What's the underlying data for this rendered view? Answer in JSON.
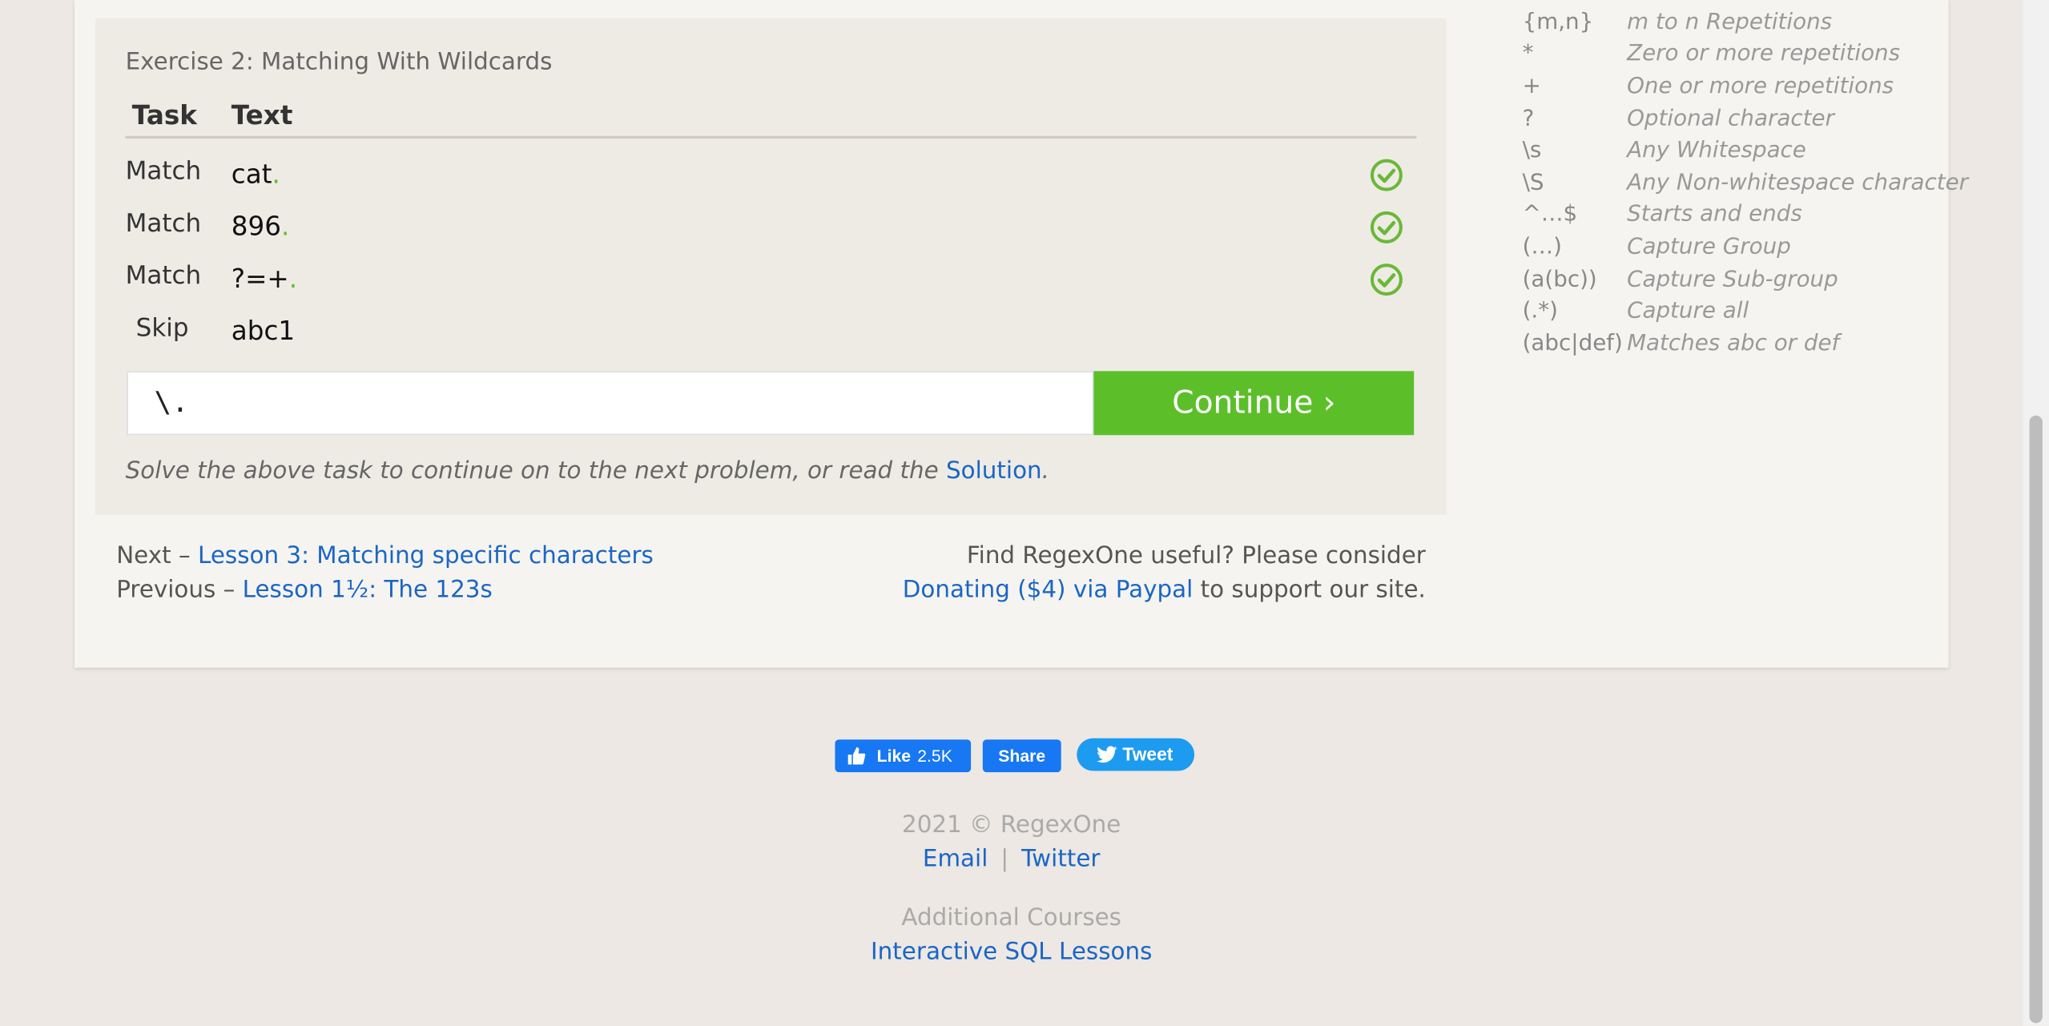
{
  "exercise": {
    "title": "Exercise 2: Matching With Wildcards",
    "col_task": "Task",
    "col_text": "Text",
    "rows": [
      {
        "task": "Match",
        "text": "cat",
        "suffix": ".",
        "status": "check-icon"
      },
      {
        "task": "Match",
        "text": "896",
        "suffix": ".",
        "status": "check-icon"
      },
      {
        "task": "Match",
        "text": "?=+",
        "suffix": ".",
        "status": "check-icon"
      },
      {
        "task": "Skip",
        "text": "abc1",
        "suffix": "",
        "status": ""
      }
    ],
    "input_value": "\\.",
    "continue_label": "Continue ›",
    "hint_prefix": "Solve the above task to continue on to the next problem, or read the ",
    "hint_link": "Solution",
    "hint_suffix": "."
  },
  "nav": {
    "next_prefix": "Next – ",
    "next_link": "Lesson 3: Matching specific characters",
    "prev_prefix": "Previous – ",
    "prev_link": "Lesson 1½: The 123s"
  },
  "donate": {
    "line1": "Find RegexOne useful? Please consider",
    "link": "Donating ($4) via Paypal",
    "line2_suffix": " to support our site."
  },
  "cheatsheet": [
    {
      "sym": "{m,n}",
      "desc": "m to n Repetitions"
    },
    {
      "sym": "*",
      "desc": "Zero or more repetitions"
    },
    {
      "sym": "+",
      "desc": "One or more repetitions"
    },
    {
      "sym": "?",
      "desc": "Optional character"
    },
    {
      "sym": "\\s",
      "desc": "Any Whitespace"
    },
    {
      "sym": "\\S",
      "desc": "Any Non-whitespace character"
    },
    {
      "sym": "^…$",
      "desc": "Starts and ends"
    },
    {
      "sym": "(…)",
      "desc": "Capture Group"
    },
    {
      "sym": "(a(bc))",
      "desc": "Capture Sub-group"
    },
    {
      "sym": "(.*)",
      "desc": "Capture all"
    },
    {
      "sym": "(abc|def)",
      "desc": "Matches abc or def"
    }
  ],
  "social": {
    "like_label": "Like",
    "like_count": "2.5K",
    "share_label": "Share",
    "tweet_label": "Tweet"
  },
  "footer": {
    "copyright": "2021 © RegexOne",
    "email": "Email",
    "separator": "|",
    "twitter": "Twitter",
    "additional": "Additional Courses",
    "sql_link": "Interactive SQL Lessons"
  },
  "colors": {
    "accent_green": "#5cbf2a",
    "link_blue": "#1a66c4",
    "facebook_blue": "#1877f2",
    "twitter_blue": "#1d9bf0"
  }
}
